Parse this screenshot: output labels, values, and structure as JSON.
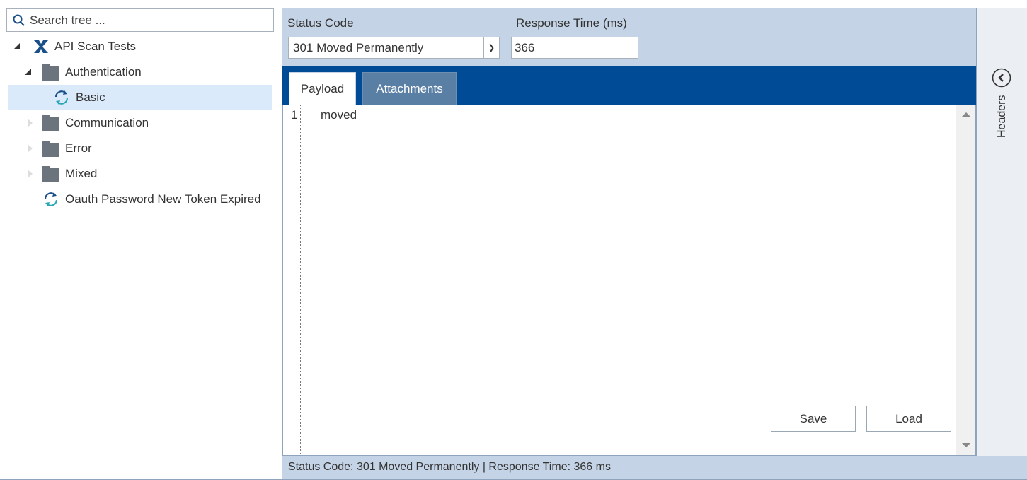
{
  "search": {
    "placeholder": "Search tree ..."
  },
  "tree": {
    "root": "API Scan Tests",
    "items": [
      {
        "label": "Authentication",
        "type": "folder",
        "expanded": true
      },
      {
        "label": "Basic",
        "type": "test",
        "selected": true
      },
      {
        "label": "Communication",
        "type": "folder"
      },
      {
        "label": "Error",
        "type": "folder"
      },
      {
        "label": "Mixed",
        "type": "folder"
      },
      {
        "label": "Oauth Password New Token Expired",
        "type": "test"
      }
    ]
  },
  "form": {
    "status_label": "Status Code",
    "status_value": "301 Moved Permanently",
    "rt_label": "Response Time (ms)",
    "rt_value": "366"
  },
  "tabs": {
    "payload": "Payload",
    "attachments": "Attachments"
  },
  "editor": {
    "line_number": "1",
    "content": "moved"
  },
  "buttons": {
    "save": "Save",
    "load": "Load"
  },
  "side": {
    "label": "Headers"
  },
  "statusbar": "Status Code: 301 Moved Permanently | Response Time: 366 ms",
  "colors": {
    "accent": "#004b96",
    "panel": "#c4d3e5",
    "selection": "#dbeafb"
  }
}
